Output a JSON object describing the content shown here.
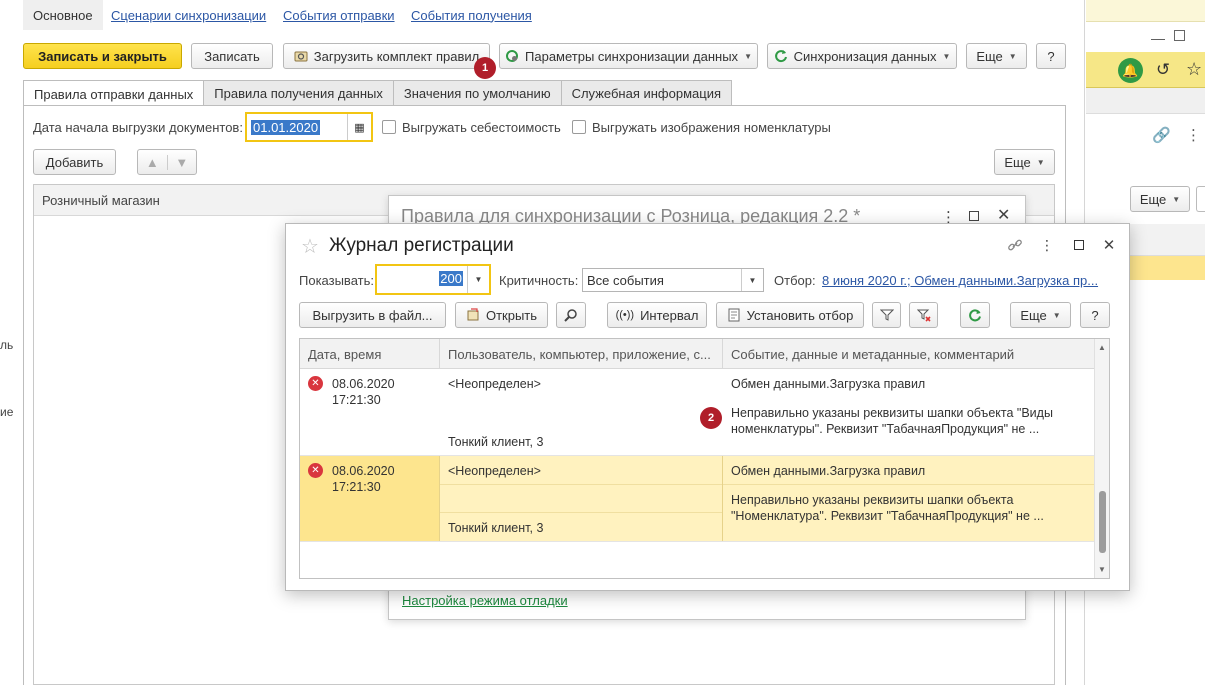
{
  "main_window": {
    "nav_tabs": [
      "Основное",
      "Сценарии синхронизации",
      "События отправки",
      "События получения"
    ],
    "toolbar": {
      "save_close": "Записать и закрыть",
      "save": "Записать",
      "load_rules": "Загрузить комплект правил",
      "sync_params": "Параметры синхронизации данных",
      "sync_data": "Синхронизация данных",
      "more": "Еще",
      "help": "?"
    },
    "form_tabs": [
      "Правила отправки данных",
      "Правила получения данных",
      "Значения по умолчанию",
      "Служебная информация"
    ],
    "date_label": "Дата начала выгрузки документов:",
    "date_value": "01.01.2020",
    "cost_checkbox": "Выгружать себестоимость",
    "images_checkbox": "Выгружать изображения номенклатуры",
    "add_button": "Добавить",
    "list_more": "Еще",
    "list_column": "Розничный магазин"
  },
  "right_pane": {
    "more": "Еще"
  },
  "rules_dialog": {
    "title": "Правила для синхронизации с Розница, редакция 2.2 *",
    "debug_link": "Настройка режима отладки"
  },
  "journal": {
    "title": "Журнал регистрации",
    "show_label": "Показывать:",
    "show_value": "200",
    "severity_label": "Критичность:",
    "severity_value": "Все события",
    "filter_label": "Отбор:",
    "filter_value": "8 июня 2020 г.; Обмен данными.Загрузка пр...",
    "toolbar": {
      "export": "Выгрузить в файл...",
      "open": "Открыть",
      "interval": "Интервал",
      "set_filter": "Установить отбор",
      "more": "Еще",
      "help": "?"
    },
    "columns": [
      "Дата, время",
      "Пользователь, компьютер, приложение, с...",
      "Событие, данные и метаданные, комментарий"
    ],
    "rows": [
      {
        "date": "08.06.2020",
        "time": "17:21:30",
        "user": "<Неопределен>",
        "client": "Тонкий клиент, 3",
        "event": "Обмен данными.Загрузка правил",
        "comment1": "Неправильно указаны реквизиты шапки объекта \"Виды",
        "comment2": "номенклатуры\". Реквизит \"ТабачнаяПродукция\" не ..."
      },
      {
        "date": "08.06.2020",
        "time": "17:21:30",
        "user": "<Неопределен>",
        "client": "Тонкий клиент, 3",
        "event": "Обмен данными.Загрузка правил",
        "comment1": "Неправильно указаны реквизиты шапки объекта",
        "comment2": "\"Номенклатура\". Реквизит \"ТабачнаяПродукция\" не ..."
      }
    ]
  },
  "markers": [
    "1",
    "2"
  ],
  "colors": {
    "accent_yellow": "#f5cf1f",
    "selected_row": "#fff2bf",
    "selected_cell": "#fde58e",
    "error_red": "#d9363e",
    "marker_red": "#b01e2a",
    "link_blue": "#2c57a5",
    "link_green": "#1d8a3f"
  }
}
